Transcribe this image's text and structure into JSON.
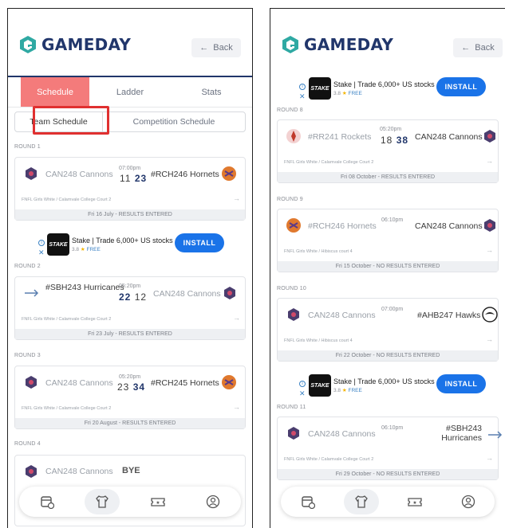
{
  "app": {
    "name": "GAMEDAY",
    "back_label": "Back"
  },
  "tabs": [
    "Schedule",
    "Ladder",
    "Stats"
  ],
  "subtabs": [
    "Team Schedule",
    "Competition Schedule"
  ],
  "ad": {
    "brand": "STAKE",
    "title": "Stake | Trade 6,000+ US stocks",
    "rating": "3.8",
    "star": "★",
    "free": "FREE",
    "install_label": "INSTALL"
  },
  "left_rounds": [
    {
      "round": "ROUND 1",
      "home": "CAN248 Cannons",
      "away": "#RCH246 Hornets",
      "time": "07:00pm",
      "home_score": "11",
      "away_score": "23",
      "venue": "FNFL Girls White / Calamvale College Court 2",
      "status": "Fri 16 July - RESULTS ENTERED"
    },
    {
      "round": "ROUND 2",
      "home": "#SBH243 Hurricanes",
      "away": "CAN248 Cannons",
      "time": "05:20pm",
      "home_score": "22",
      "away_score": "12",
      "venue": "FNFL Girls White / Calamvale College Court 2",
      "status": "Fri 23 July - RESULTS ENTERED"
    },
    {
      "round": "ROUND 3",
      "home": "CAN248 Cannons",
      "away": "#RCH245 Hornets",
      "time": "05:20pm",
      "home_score": "23",
      "away_score": "34",
      "venue": "FNFL Girls White / Calamvale College Court 2",
      "status": "Fri 20 August - RESULTS ENTERED"
    },
    {
      "round": "ROUND 4",
      "home": "CAN248 Cannons",
      "bye": "BYE"
    }
  ],
  "right_rounds": [
    {
      "round": "ROUND 8",
      "home": "#RR241 Rockets",
      "away": "CAN248 Cannons",
      "time": "05:20pm",
      "home_score": "18",
      "away_score": "38",
      "venue": "FNFL Girls White / Calamvale College Court 2",
      "status": "Fri 08 October - RESULTS ENTERED"
    },
    {
      "round": "ROUND 9",
      "home": "#RCH246 Hornets",
      "away": "CAN248 Cannons",
      "time": "06:10pm",
      "venue": "FNFL Girls White / Hibiscus court 4",
      "status": "Fri 15 October - NO RESULTS ENTERED"
    },
    {
      "round": "ROUND 10",
      "home": "CAN248 Cannons",
      "away": "#AHB247 Hawks",
      "time": "07:00pm",
      "venue": "FNFL Girls White / Hibiscus court 4",
      "status": "Fri 22 October - NO RESULTS ENTERED"
    },
    {
      "round": "ROUND 11",
      "home": "CAN248 Cannons",
      "away": "#SBH243 Hurricanes",
      "time": "06:10pm",
      "venue": "FNFL Girls White / Calamvale College Court 2",
      "status": "Fri 29 October - NO RESULTS ENTERED"
    }
  ],
  "nav_icons": [
    "calendar-icon",
    "jersey-icon",
    "ticket-icon",
    "profile-icon"
  ],
  "colors": {
    "brand": "#21366b",
    "logo_accent": "#2fa9a3",
    "active_tab": "#f47b7b",
    "install": "#1a73e8",
    "highlight": "#e03030"
  }
}
